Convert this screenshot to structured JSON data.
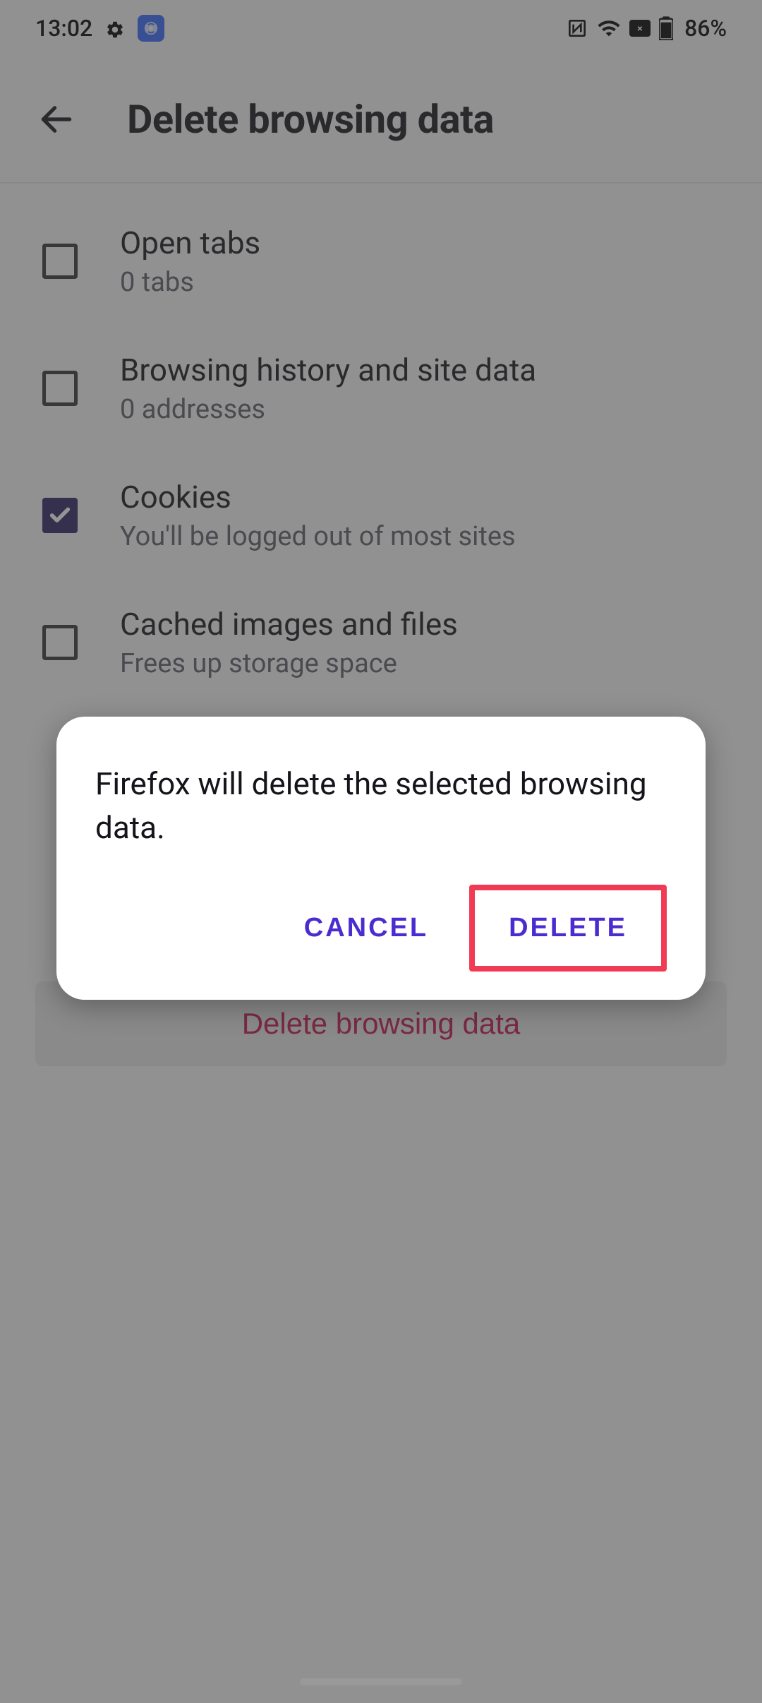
{
  "status": {
    "time": "13:02",
    "battery": "86%"
  },
  "header": {
    "title": "Delete browsing data"
  },
  "items": [
    {
      "title": "Open tabs",
      "subtitle": "0 tabs",
      "checked": false
    },
    {
      "title": "Browsing history and site data",
      "subtitle": "0 addresses",
      "checked": false
    },
    {
      "title": "Cookies",
      "subtitle": "You'll be logged out of most sites",
      "checked": true
    },
    {
      "title": "Cached images and files",
      "subtitle": "Frees up storage space",
      "checked": false
    }
  ],
  "delete_button": "Delete browsing data",
  "dialog": {
    "message": "Firefox will delete the selected browsing data.",
    "cancel": "CANCEL",
    "confirm": "DELETE"
  }
}
